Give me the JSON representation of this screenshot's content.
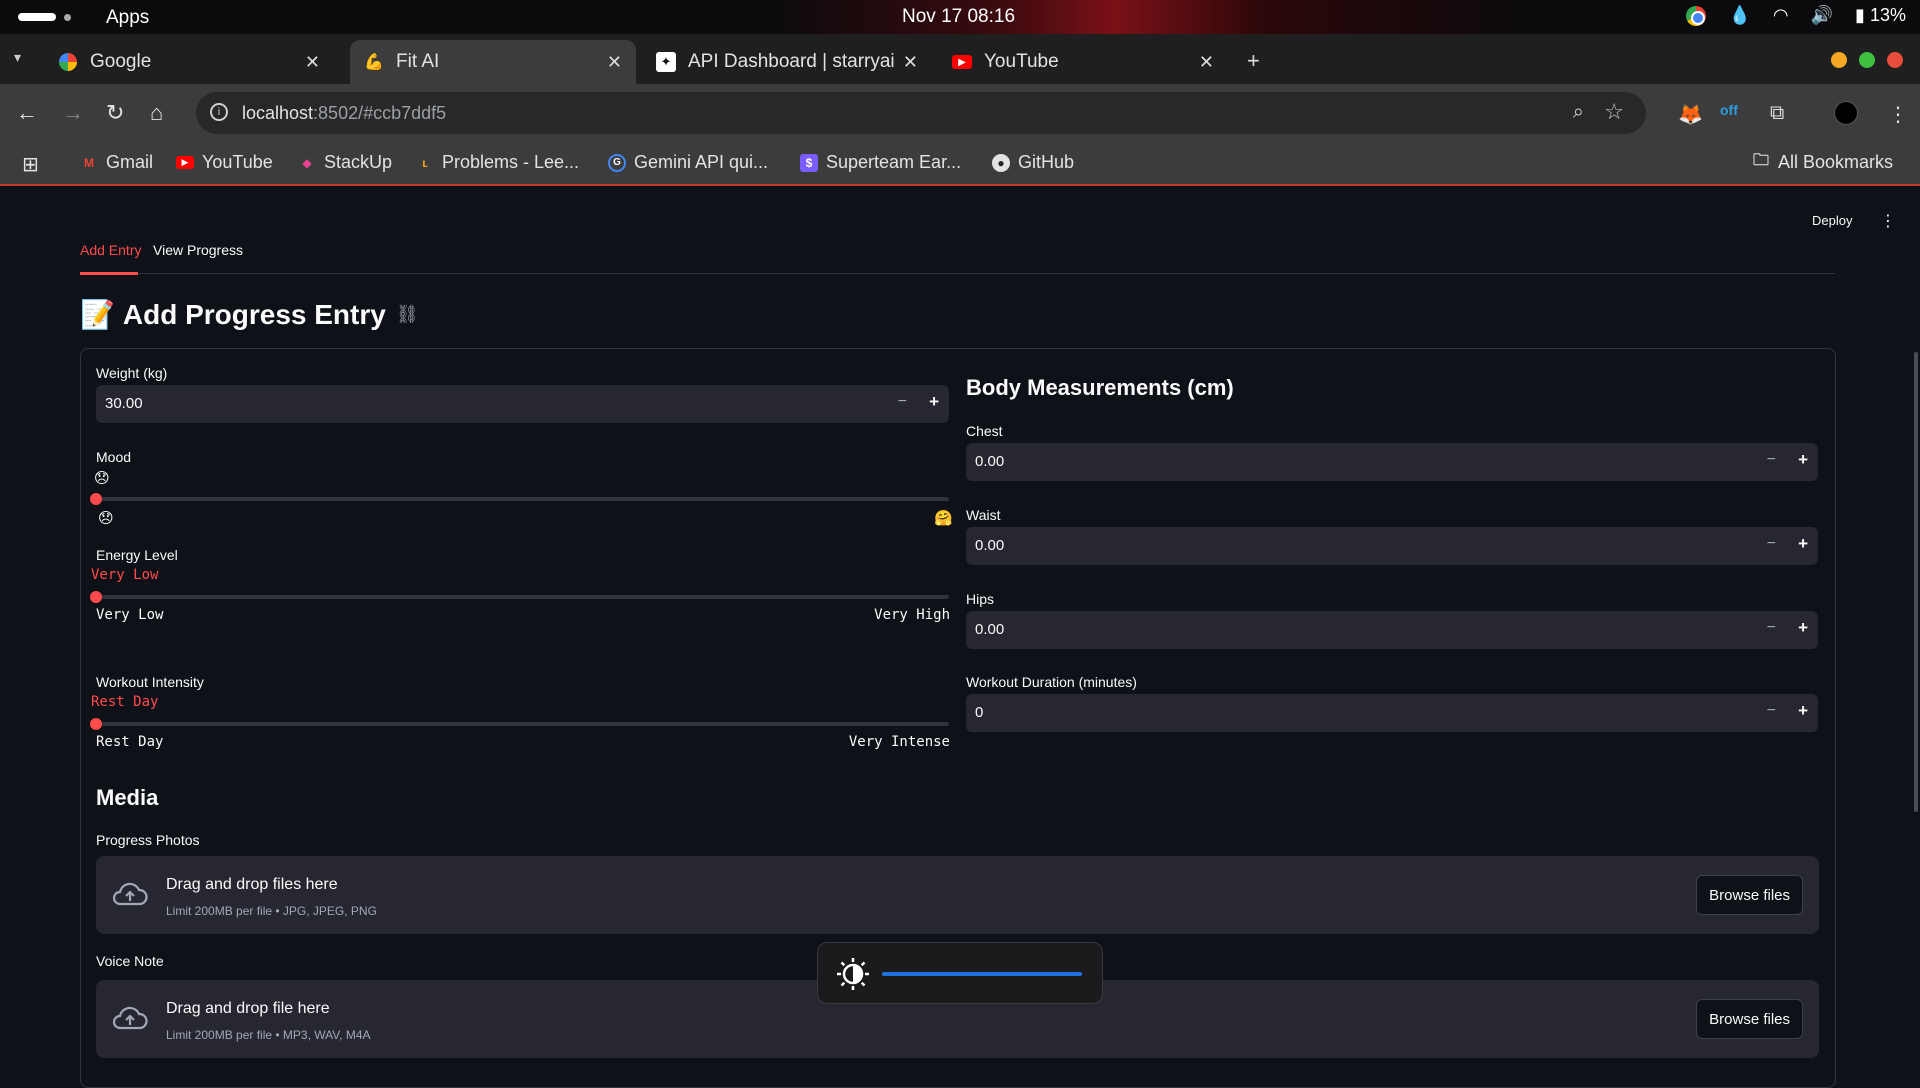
{
  "os": {
    "apps_label": "Apps",
    "datetime": "Nov 17  08:16",
    "battery": "13%"
  },
  "browser": {
    "tabs": [
      {
        "title": "Google",
        "icon": "google-icon"
      },
      {
        "title": "Fit AI",
        "icon": "flexed-arm-icon",
        "active": true
      },
      {
        "title": "API Dashboard | starryai",
        "icon": "starryai-icon"
      },
      {
        "title": "YouTube",
        "icon": "youtube-icon"
      }
    ],
    "url_host": "localhost",
    "url_rest": ":8502/#ccb7ddf5",
    "bookmarks": [
      {
        "label": "Gmail",
        "icon": "gmail-icon"
      },
      {
        "label": "YouTube",
        "icon": "youtube-icon"
      },
      {
        "label": "StackUp",
        "icon": "stackup-icon"
      },
      {
        "label": "Problems - Lee...",
        "icon": "leetcode-icon"
      },
      {
        "label": "Gemini API qui...",
        "icon": "google-icon"
      },
      {
        "label": "Superteam Ear...",
        "icon": "superteam-icon"
      },
      {
        "label": "GitHub",
        "icon": "github-icon"
      }
    ],
    "all_bookmarks": "All Bookmarks"
  },
  "app": {
    "deploy": "Deploy",
    "tabs": [
      "Add Entry",
      "View Progress"
    ],
    "title": "Add Progress Entry",
    "title_emoji": "📝",
    "weight": {
      "label": "Weight (kg)",
      "value": "30.00"
    },
    "mood": {
      "label": "Mood",
      "current": "😞",
      "min": "😞",
      "max": "🤗",
      "level": 0
    },
    "energy": {
      "label": "Energy Level",
      "current": "Very Low",
      "min": "Very Low",
      "max": "Very High",
      "level": 0
    },
    "intensity": {
      "label": "Workout Intensity",
      "current": "Rest Day",
      "min": "Rest Day",
      "max": "Very Intense",
      "level": 0
    },
    "measurements": {
      "heading": "Body Measurements (cm)",
      "chest": {
        "label": "Chest",
        "value": "0.00"
      },
      "waist": {
        "label": "Waist",
        "value": "0.00"
      },
      "hips": {
        "label": "Hips",
        "value": "0.00"
      },
      "duration": {
        "label": "Workout Duration (minutes)",
        "value": "0"
      }
    },
    "media": {
      "heading": "Media",
      "photos": {
        "label": "Progress Photos",
        "drop": "Drag and drop files here",
        "limit": "Limit 200MB per file • JPG, JPEG, PNG",
        "button": "Browse files"
      },
      "voice": {
        "label": "Voice Note",
        "drop": "Drag and drop file here",
        "limit": "Limit 200MB per file • MP3, WAV, M4A",
        "button": "Browse files"
      }
    }
  },
  "osd": {
    "type": "brightness",
    "level": 1.0
  },
  "colors": {
    "accent": "#ff4b4b",
    "background": "#0e1117",
    "input": "#262730"
  }
}
